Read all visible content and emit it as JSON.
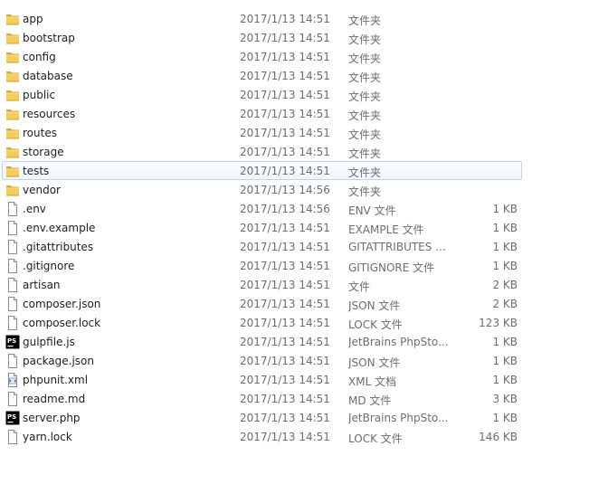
{
  "files": [
    {
      "name": "app",
      "date": "2017/1/13 14:51",
      "type": "文件夹",
      "size": "",
      "icon": "folder-icon"
    },
    {
      "name": "bootstrap",
      "date": "2017/1/13 14:51",
      "type": "文件夹",
      "size": "",
      "icon": "folder-icon"
    },
    {
      "name": "config",
      "date": "2017/1/13 14:51",
      "type": "文件夹",
      "size": "",
      "icon": "folder-icon"
    },
    {
      "name": "database",
      "date": "2017/1/13 14:51",
      "type": "文件夹",
      "size": "",
      "icon": "folder-icon"
    },
    {
      "name": "public",
      "date": "2017/1/13 14:51",
      "type": "文件夹",
      "size": "",
      "icon": "folder-icon"
    },
    {
      "name": "resources",
      "date": "2017/1/13 14:51",
      "type": "文件夹",
      "size": "",
      "icon": "folder-icon"
    },
    {
      "name": "routes",
      "date": "2017/1/13 14:51",
      "type": "文件夹",
      "size": "",
      "icon": "folder-icon"
    },
    {
      "name": "storage",
      "date": "2017/1/13 14:51",
      "type": "文件夹",
      "size": "",
      "icon": "folder-icon"
    },
    {
      "name": "tests",
      "date": "2017/1/13 14:51",
      "type": "文件夹",
      "size": "",
      "icon": "folder-icon",
      "selected": true
    },
    {
      "name": "vendor",
      "date": "2017/1/13 14:56",
      "type": "文件夹",
      "size": "",
      "icon": "folder-icon"
    },
    {
      "name": ".env",
      "date": "2017/1/13 14:56",
      "type": "ENV 文件",
      "size": "1 KB",
      "icon": "file-icon"
    },
    {
      "name": ".env.example",
      "date": "2017/1/13 14:51",
      "type": "EXAMPLE 文件",
      "size": "1 KB",
      "icon": "file-icon"
    },
    {
      "name": ".gitattributes",
      "date": "2017/1/13 14:51",
      "type": "GITATTRIBUTES ...",
      "size": "1 KB",
      "icon": "file-icon"
    },
    {
      "name": ".gitignore",
      "date": "2017/1/13 14:51",
      "type": "GITIGNORE 文件",
      "size": "1 KB",
      "icon": "file-icon"
    },
    {
      "name": "artisan",
      "date": "2017/1/13 14:51",
      "type": "文件",
      "size": "2 KB",
      "icon": "file-icon"
    },
    {
      "name": "composer.json",
      "date": "2017/1/13 14:51",
      "type": "JSON 文件",
      "size": "2 KB",
      "icon": "file-icon"
    },
    {
      "name": "composer.lock",
      "date": "2017/1/13 14:51",
      "type": "LOCK 文件",
      "size": "123 KB",
      "icon": "file-icon"
    },
    {
      "name": "gulpfile.js",
      "date": "2017/1/13 14:51",
      "type": "JetBrains PhpSto...",
      "size": "1 KB",
      "icon": "phpstorm-icon"
    },
    {
      "name": "package.json",
      "date": "2017/1/13 14:51",
      "type": "JSON 文件",
      "size": "1 KB",
      "icon": "file-icon"
    },
    {
      "name": "phpunit.xml",
      "date": "2017/1/13 14:51",
      "type": "XML 文档",
      "size": "1 KB",
      "icon": "xml-file-icon"
    },
    {
      "name": "readme.md",
      "date": "2017/1/13 14:51",
      "type": "MD 文件",
      "size": "3 KB",
      "icon": "file-icon"
    },
    {
      "name": "server.php",
      "date": "2017/1/13 14:51",
      "type": "JetBrains PhpSto...",
      "size": "1 KB",
      "icon": "phpstorm-icon"
    },
    {
      "name": "yarn.lock",
      "date": "2017/1/13 14:51",
      "type": "LOCK 文件",
      "size": "146 KB",
      "icon": "file-icon"
    }
  ],
  "colors": {
    "selection_bg": "#f1f6fc",
    "selection_border": "#b9d6f1",
    "secondary_text": "#6d6d6d"
  }
}
